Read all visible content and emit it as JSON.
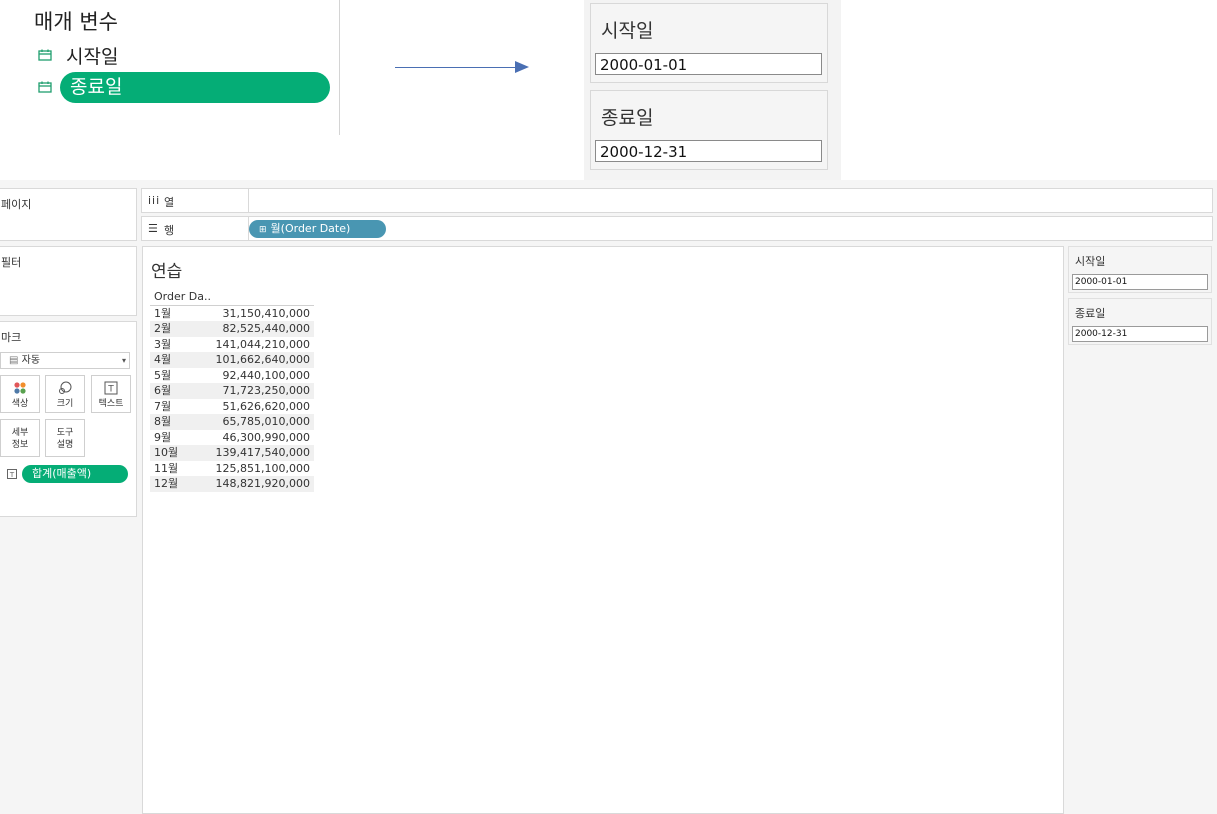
{
  "parameters_panel": {
    "title": "매개 변수",
    "items": [
      {
        "label": "시작일",
        "icon": "calendar-icon",
        "selected": false
      },
      {
        "label": "종료일",
        "icon": "calendar-icon",
        "selected": true
      }
    ]
  },
  "parameter_cards_large": [
    {
      "label": "시작일",
      "value": "2000-01-01"
    },
    {
      "label": "종료일",
      "value": "2000-12-31"
    }
  ],
  "shelves": {
    "pages_label": "페이지",
    "filters_label": "필터",
    "columns_label": "열",
    "rows_label": "행",
    "rows_pill": "월(Order Date)"
  },
  "marks": {
    "title": "마크",
    "type_select": "자동",
    "buttons": {
      "color": "색상",
      "size": "크기",
      "text": "텍스트",
      "detail_line1": "세부",
      "detail_line2": "정보",
      "tooltip_line1": "도구",
      "tooltip_line2": "설명"
    },
    "text_pill": "합계(매출액)"
  },
  "view": {
    "sheet_title": "연습",
    "column_header": "Order Da..",
    "rows": [
      {
        "month": "1월",
        "value": "31,150,410,000"
      },
      {
        "month": "2월",
        "value": "82,525,440,000"
      },
      {
        "month": "3월",
        "value": "141,044,210,000"
      },
      {
        "month": "4월",
        "value": "101,662,640,000"
      },
      {
        "month": "5월",
        "value": "92,440,100,000"
      },
      {
        "month": "6월",
        "value": "71,723,250,000"
      },
      {
        "month": "7월",
        "value": "51,626,620,000"
      },
      {
        "month": "8월",
        "value": "65,785,010,000"
      },
      {
        "month": "9월",
        "value": "46,300,990,000"
      },
      {
        "month": "10월",
        "value": "139,417,540,000"
      },
      {
        "month": "11월",
        "value": "125,851,100,000"
      },
      {
        "month": "12월",
        "value": "148,821,920,000"
      }
    ]
  },
  "parameter_cards_small": [
    {
      "label": "시작일",
      "value": "2000-01-01"
    },
    {
      "label": "종료일",
      "value": "2000-12-31"
    }
  ],
  "colors": {
    "accent_green": "#05ad76",
    "pill_blue": "#4996b2",
    "arrow_blue": "#4a6fb3"
  }
}
